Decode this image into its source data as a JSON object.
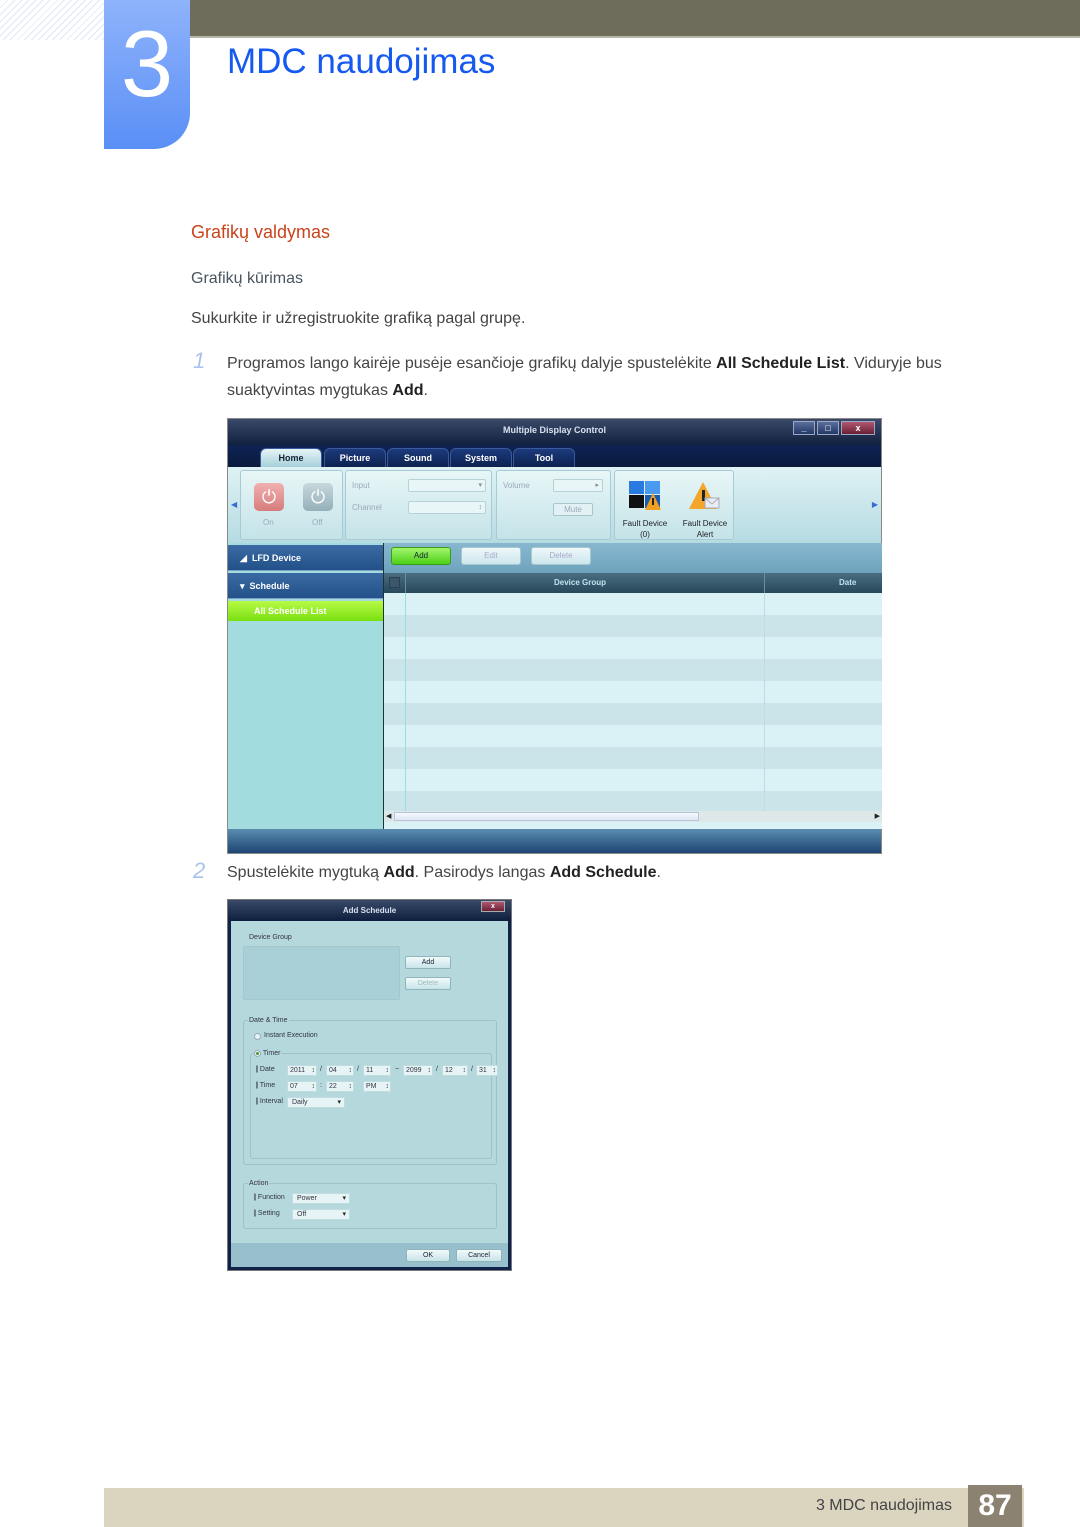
{
  "header": {
    "chapter_number": "3",
    "chapter_title": "MDC naudojimas"
  },
  "section": {
    "heading": "Grafikų valdymas",
    "subheading": "Grafikų kūrimas",
    "intro": "Sukurkite ir užregistruokite grafiką pagal grupę."
  },
  "steps": [
    {
      "number": "1",
      "text_parts": [
        "Programos lango kairėje pusėje esančioje grafikų dalyje spustelėkite ",
        "All Schedule List",
        ". Viduryje bus suaktyvintas mygtukas ",
        "Add",
        "."
      ]
    },
    {
      "number": "2",
      "text_parts": [
        "Spustelėkite mygtuką ",
        "Add",
        ". Pasirodys langas ",
        "Add Schedule",
        "."
      ]
    }
  ],
  "mdc_window": {
    "title": "Multiple Display Control",
    "controls": {
      "minimize": "_",
      "maximize": "□",
      "close": "x"
    },
    "help_icon": "?",
    "tabs": [
      {
        "label": "Home",
        "active": true
      },
      {
        "label": "Picture",
        "active": false
      },
      {
        "label": "Sound",
        "active": false
      },
      {
        "label": "System",
        "active": false
      },
      {
        "label": "Tool",
        "active": false
      }
    ],
    "ribbon": {
      "power_on_label": "On",
      "power_off_label": "Off",
      "input_label": "Input",
      "channel_label": "Channel",
      "volume_label": "Volume",
      "mute_label": "Mute",
      "fault_device_label": "Fault Device",
      "fault_device_count": "(0)",
      "fault_alert_label": "Fault Device",
      "fault_alert_sub": "Alert"
    },
    "sidebar": {
      "items": [
        {
          "label": "LFD Device",
          "icon": "triangle-collapsed-icon"
        },
        {
          "label": "Schedule",
          "icon": "triangle-expanded-icon"
        }
      ],
      "selected_sub": "All Schedule List"
    },
    "toolbar": {
      "add_label": "Add",
      "edit_label": "Edit",
      "delete_label": "Delete"
    },
    "table": {
      "columns": [
        "Device Group",
        "Date"
      ],
      "rows": []
    }
  },
  "add_schedule_dialog": {
    "title": "Add Schedule",
    "close": "x",
    "device_group_label": "Device Group",
    "add_label": "Add",
    "delete_label": "Delete",
    "date_time_legend": "Date & Time",
    "instant_execution_label": "Instant Execution",
    "timer_label": "Timer",
    "timer_selected": true,
    "date_label": "Date",
    "start_date": {
      "year": "2011",
      "month": "04",
      "day": "11"
    },
    "end_date": {
      "year": "2099",
      "month": "12",
      "day": "31"
    },
    "date_range_sep": "~",
    "date_sep": "/",
    "time_label": "Time",
    "time": {
      "hour": "07",
      "minute": "22",
      "ampm": "PM"
    },
    "time_sep": ":",
    "interval_label": "Interval",
    "interval_value": "Daily",
    "action_legend": "Action",
    "function_label": "Function",
    "function_value": "Power",
    "setting_label": "Setting",
    "setting_value": "Off",
    "ok_label": "OK",
    "cancel_label": "Cancel"
  },
  "footer": {
    "chapter_label": "3 MDC naudojimas",
    "page_number": "87"
  }
}
